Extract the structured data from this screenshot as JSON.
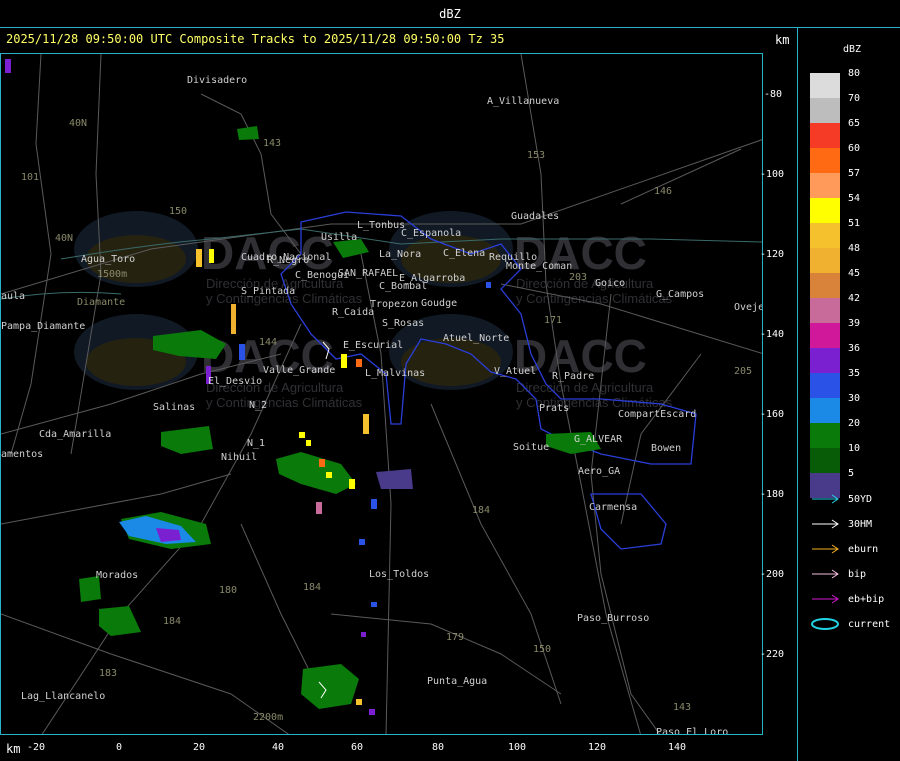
{
  "window": {
    "title": "dBZ"
  },
  "header": {
    "text": "2025/11/28 09:50:00 UTC Composite Tracks to 2025/11/28 09:50:00 Tz 35",
    "km_top": "km",
    "km_bottom": "km"
  },
  "legend": {
    "title": "dBZ",
    "entries": [
      {
        "label": "80",
        "color": "#dcdcdc"
      },
      {
        "label": "70",
        "color": "#bdbdbd"
      },
      {
        "label": "65",
        "color": "#f53a26"
      },
      {
        "label": "60",
        "color": "#ff6a12"
      },
      {
        "label": "57",
        "color": "#ff9a5a"
      },
      {
        "label": "54",
        "color": "#ffff00"
      },
      {
        "label": "51",
        "color": "#f5c22e"
      },
      {
        "label": "48",
        "color": "#f0b030"
      },
      {
        "label": "45",
        "color": "#d8823a"
      },
      {
        "label": "42",
        "color": "#c86a9a"
      },
      {
        "label": "39",
        "color": "#d0189a"
      },
      {
        "label": "36",
        "color": "#7a20d0"
      },
      {
        "label": "35",
        "color": "#2a52e6"
      },
      {
        "label": "30",
        "color": "#1a8ae6"
      },
      {
        "label": "20",
        "color": "#0a7a0a"
      },
      {
        "label": "10",
        "color": "#085c08"
      },
      {
        "label": "5",
        "color": "#4a3a8a"
      }
    ],
    "tracks": [
      {
        "label": "50YD",
        "color": "#22d3e6"
      },
      {
        "label": "30HM",
        "color": "#ffffff"
      },
      {
        "label": "eburn",
        "color": "#f5b020"
      },
      {
        "label": "bip",
        "color": "#f6bede"
      },
      {
        "label": "eb+bip",
        "color": "#d01ad0"
      },
      {
        "label": "current",
        "color": "#22d3e6"
      }
    ]
  },
  "axes": {
    "x_ticks": [
      "-20",
      "0",
      "20",
      "40",
      "60",
      "80",
      "100",
      "120",
      "140"
    ],
    "y_ticks": [
      "-80",
      "-100",
      "-120",
      "-140",
      "-160",
      "-180",
      "-200",
      "-220"
    ]
  },
  "watermark": {
    "logo_text": "DACC",
    "sub1": "Dirección de Agricultura",
    "sub2": "y Contingencias Climáticas",
    "url": "http://www.contingencias.mendoza.gov.ar"
  },
  "places": [
    {
      "label": "Divisadero"
    },
    {
      "label": "A_Villanueva"
    },
    {
      "label": "153"
    },
    {
      "label": "146"
    },
    {
      "label": "143"
    },
    {
      "label": "40N"
    },
    {
      "label": "101"
    },
    {
      "label": "150"
    },
    {
      "label": "40N"
    },
    {
      "label": "Agua_Toro"
    },
    {
      "label": "1500m"
    },
    {
      "label": "Diamante"
    },
    {
      "label": "aula"
    },
    {
      "label": "Pampa_Diamante"
    },
    {
      "label": "L_Tonbus"
    },
    {
      "label": "Usilla"
    },
    {
      "label": "C_Espanola"
    },
    {
      "label": "Guadales"
    },
    {
      "label": "La_Nora"
    },
    {
      "label": "C_Elena"
    },
    {
      "label": "Requillo"
    },
    {
      "label": "Monte_Coman"
    },
    {
      "label": "203"
    },
    {
      "label": "Goico"
    },
    {
      "label": "G_Campos"
    },
    {
      "label": "Oveje"
    },
    {
      "label": "Cuadro_Nacional"
    },
    {
      "label": "R_Negro"
    },
    {
      "label": "C_Benogui"
    },
    {
      "label": "SAN_RAFAEL"
    },
    {
      "label": "E_Algarroba"
    },
    {
      "label": "C_Bombal"
    },
    {
      "label": "S_Pintada"
    },
    {
      "label": "Tropezon"
    },
    {
      "label": "Goudge"
    },
    {
      "label": "R_Caida"
    },
    {
      "label": "S_Rosas"
    },
    {
      "label": "171"
    },
    {
      "label": "Atuel_Norte"
    },
    {
      "label": "E_Escurial"
    },
    {
      "label": "144"
    },
    {
      "label": "Valle_Grande"
    },
    {
      "label": "L_Malvinas"
    },
    {
      "label": "V_Atuel"
    },
    {
      "label": "R_Padre"
    },
    {
      "label": "El_Desvio"
    },
    {
      "label": "205"
    },
    {
      "label": "Salinas"
    },
    {
      "label": "N_2"
    },
    {
      "label": "Prats"
    },
    {
      "label": "CompartEscard"
    },
    {
      "label": "Cda_Amarilla"
    },
    {
      "label": "N_1"
    },
    {
      "label": "Nihuil"
    },
    {
      "label": "G_ALVEAR"
    },
    {
      "label": "Bowen"
    },
    {
      "label": "amentos"
    },
    {
      "label": "Soitue"
    },
    {
      "label": "Aero_GA"
    },
    {
      "label": "Carmensa"
    },
    {
      "label": "184"
    },
    {
      "label": "Morados"
    },
    {
      "label": "Los_Toldos"
    },
    {
      "label": "180"
    },
    {
      "label": "184"
    },
    {
      "label": "Paso_Burroso"
    },
    {
      "label": "184"
    },
    {
      "label": "179"
    },
    {
      "label": "150"
    },
    {
      "label": "183"
    },
    {
      "label": "Lag_Llancanelo"
    },
    {
      "label": "Punta_Agua"
    },
    {
      "label": "2200m"
    },
    {
      "label": "143"
    },
    {
      "label": "Paso_El_Loro"
    }
  ]
}
